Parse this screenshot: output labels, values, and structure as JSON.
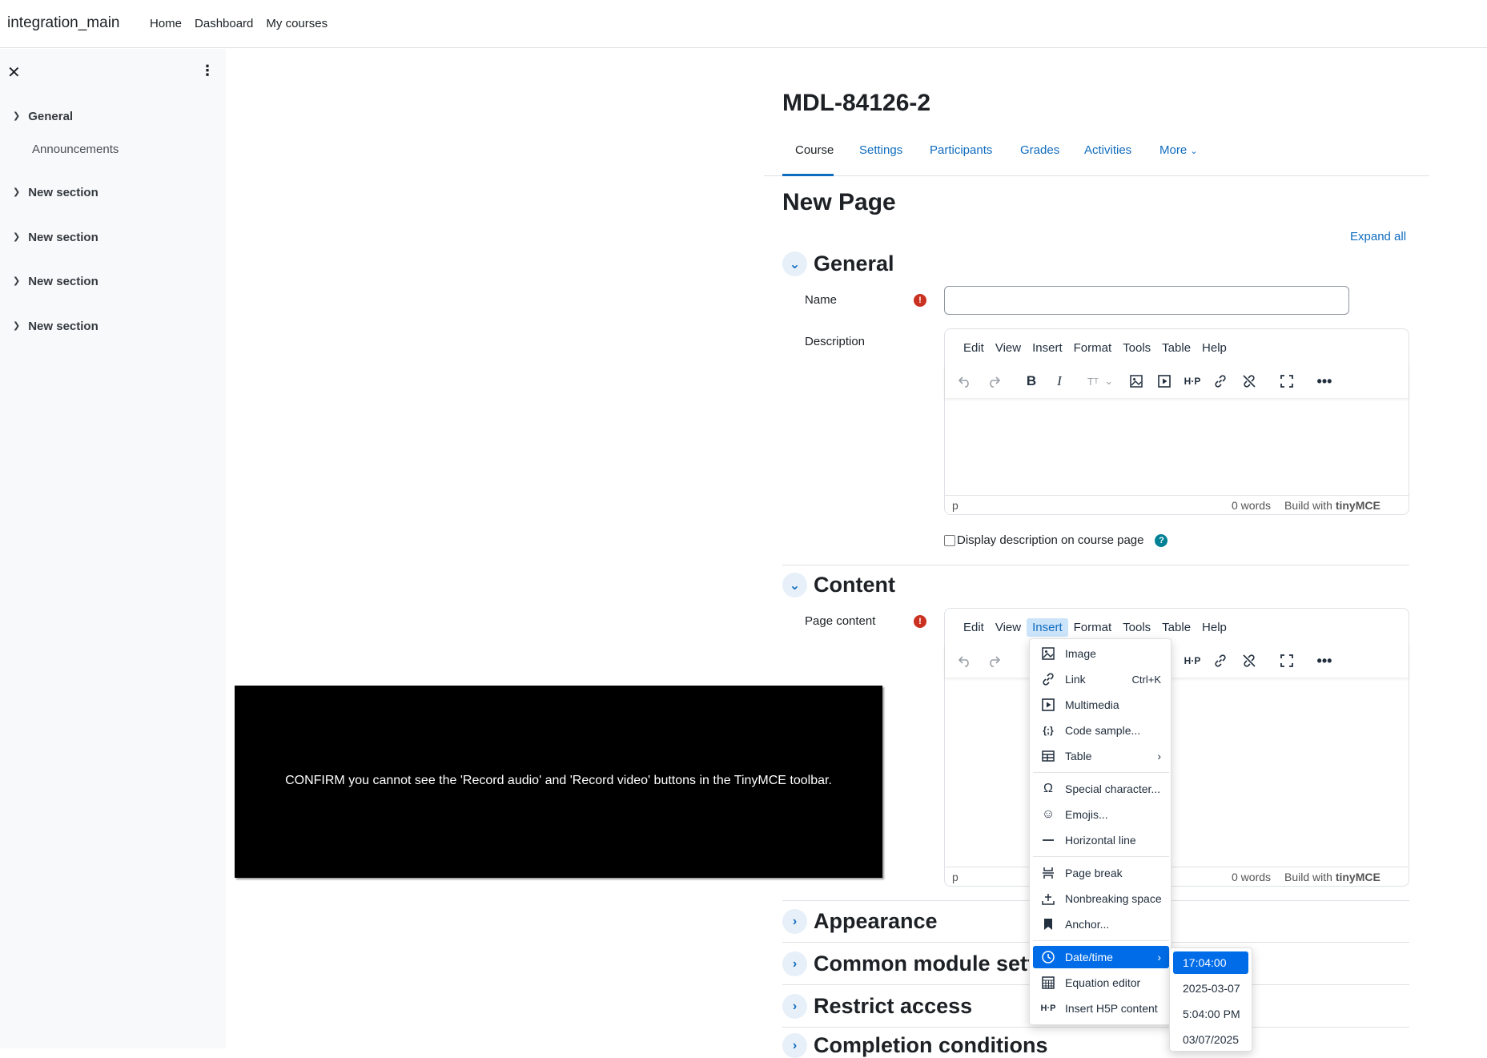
{
  "navbar": {
    "site_name": "integration_main",
    "links": [
      "Home",
      "Dashboard",
      "My courses"
    ]
  },
  "drawer": {
    "close_glyph": "✕",
    "kebab_glyph": "⋮",
    "sections": [
      {
        "title": "General",
        "items": [
          "Announcements"
        ]
      },
      {
        "title": "New section",
        "items": []
      },
      {
        "title": "New section",
        "items": []
      },
      {
        "title": "New section",
        "items": []
      },
      {
        "title": "New section",
        "items": []
      }
    ]
  },
  "course": {
    "title": "MDL-84126-2",
    "tabs": [
      "Course",
      "Settings",
      "Participants",
      "Grades",
      "Activities",
      "More"
    ],
    "active_tab": "Course"
  },
  "page": {
    "heading": "New Page",
    "expand_all": "Expand all"
  },
  "general": {
    "heading": "General",
    "name_label": "Name",
    "name_value": "",
    "description_label": "Description",
    "display_description": "Display description on course page",
    "display_description_checked": false
  },
  "content": {
    "heading": "Content",
    "page_content_label": "Page content"
  },
  "editor": {
    "menus": [
      "Edit",
      "View",
      "Insert",
      "Format",
      "Tools",
      "Table",
      "Help"
    ],
    "status_path": "p",
    "word_count": "0 words",
    "build_with": "Build with",
    "brand": "tinyMCE"
  },
  "collapsed_sections": [
    "Appearance",
    "Common module setti",
    "Restrict access",
    "Completion conditions"
  ],
  "overlay": {
    "message": "CONFIRM you cannot see the 'Record audio' and 'Record video' buttons in the TinyMCE toolbar."
  },
  "insert_menu": {
    "items": [
      {
        "label": "Image",
        "icon": "image-icon"
      },
      {
        "label": "Link",
        "icon": "link-icon",
        "shortcut": "Ctrl+K"
      },
      {
        "label": "Multimedia",
        "icon": "multimedia-icon"
      },
      {
        "label": "Code sample...",
        "icon": "code-sample-icon"
      },
      {
        "label": "Table",
        "icon": "table-icon",
        "submenu": true
      },
      {
        "label": "Special character...",
        "icon": "omega-icon"
      },
      {
        "label": "Emojis...",
        "icon": "emoji-icon"
      },
      {
        "label": "Horizontal line",
        "icon": "horizontal-line-icon"
      },
      {
        "label": "Page break",
        "icon": "page-break-icon"
      },
      {
        "label": "Nonbreaking space",
        "icon": "nonbreaking-space-icon"
      },
      {
        "label": "Anchor...",
        "icon": "bookmark-icon"
      },
      {
        "label": "Date/time",
        "icon": "clock-icon",
        "submenu": true,
        "selected": true
      },
      {
        "label": "Equation editor",
        "icon": "calculator-icon"
      },
      {
        "label": "Insert H5P content",
        "icon": "h5p-icon"
      }
    ]
  },
  "datetime_menu": {
    "items": [
      "17:04:00",
      "2025-03-07",
      "5:04:00 PM",
      "03/07/2025"
    ],
    "selected": "17:04:00"
  },
  "colors": {
    "link": "#0f6cbf",
    "required": "#ca3120",
    "help": "#008196",
    "menu_selected": "#006ce7"
  }
}
